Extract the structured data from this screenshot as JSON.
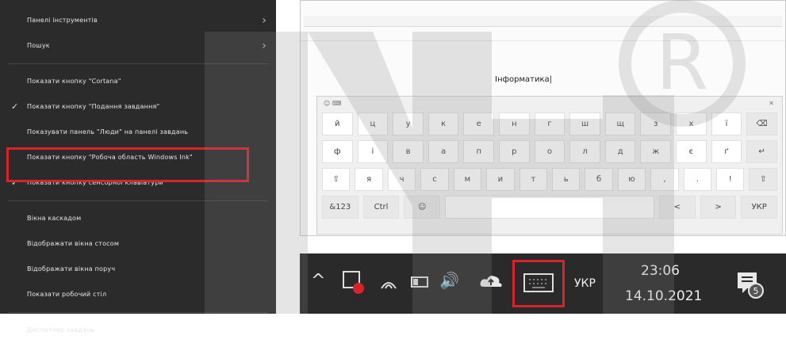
{
  "menu": {
    "items": [
      {
        "label": "Панелі інструментів",
        "chevron": true,
        "checked": false
      },
      {
        "label": "Пошук",
        "chevron": true,
        "checked": false
      },
      {
        "label": "Показати кнопку \"Cortana\"",
        "chevron": false,
        "checked": false
      },
      {
        "label": "Показати кнопку \"Подання завдання\"",
        "chevron": false,
        "checked": true
      },
      {
        "label": "Показувати панель \"Люди\" на панелі завдань",
        "chevron": false,
        "checked": false
      },
      {
        "label": "Показати кнопку \"Робоча область Windows Ink\"",
        "chevron": false,
        "checked": false
      },
      {
        "label": "Показати кнопку сенсорної клавіатури",
        "chevron": false,
        "checked": true
      },
      {
        "label": "Вікна каскадом",
        "chevron": false,
        "checked": false
      },
      {
        "label": "Відображати вікна стосом",
        "chevron": false,
        "checked": false
      },
      {
        "label": "Відображати вікна поруч",
        "chevron": false,
        "checked": false
      },
      {
        "label": "Показати робочий стіл",
        "chevron": false,
        "checked": false
      },
      {
        "label": "Диспетчер завдань",
        "chevron": false,
        "checked": false
      }
    ]
  },
  "doc": {
    "typed_text": "Інформатика|"
  },
  "keyboard": {
    "rows": [
      [
        "й",
        "ц",
        "у",
        "к",
        "е",
        "н",
        "г",
        "ш",
        "щ",
        "з",
        "х",
        "ї",
        "⌫"
      ],
      [
        "ф",
        "і",
        "в",
        "а",
        "п",
        "р",
        "о",
        "л",
        "д",
        "ж",
        "є",
        "ґ",
        "↵"
      ],
      [
        "⇧",
        "я",
        "ч",
        "с",
        "м",
        "и",
        "т",
        "ь",
        "б",
        "ю",
        ",",
        ".",
        "!",
        "⇧"
      ],
      [
        "&123",
        "Ctrl",
        "☺",
        "space",
        "<",
        ">",
        "УКР"
      ]
    ]
  },
  "taskbar": {
    "lang": "УКР",
    "time": "23:06",
    "date": "14.10.2021",
    "notification_count": "5"
  }
}
